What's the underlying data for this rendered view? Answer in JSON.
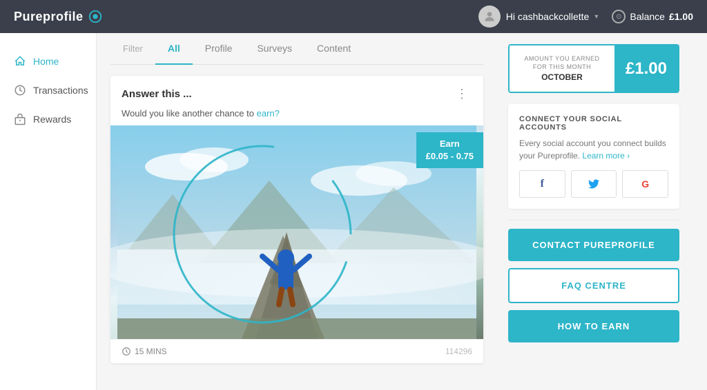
{
  "app": {
    "logo_text": "Pureprofile",
    "logo_icon": "◉"
  },
  "nav": {
    "user_greeting": "Hi cashbackcollette",
    "balance_label": "Balance",
    "balance_amount": "£1.00"
  },
  "sidebar": {
    "items": [
      {
        "id": "home",
        "label": "Home",
        "active": true,
        "icon": "home"
      },
      {
        "id": "transactions",
        "label": "Transactions",
        "active": false,
        "icon": "transactions"
      },
      {
        "id": "rewards",
        "label": "Rewards",
        "active": false,
        "icon": "rewards"
      }
    ]
  },
  "filter_tabs": {
    "static_label": "Filter",
    "tabs": [
      {
        "id": "all",
        "label": "All",
        "active": true
      },
      {
        "id": "profile",
        "label": "Profile",
        "active": false
      },
      {
        "id": "surveys",
        "label": "Surveys",
        "active": false
      },
      {
        "id": "content",
        "label": "Content",
        "active": false
      }
    ]
  },
  "card": {
    "title": "Answer this ...",
    "subtitle": "Would you like another chance to earn?",
    "subtitle_link": "earn",
    "earn_label_line1": "Earn",
    "earn_label_line2": "£0.05 - 0.75",
    "time_label": "15 MINS",
    "card_id": "114296"
  },
  "right_panel": {
    "earnings": {
      "top_text": "AMOUNT YOU EARNED FOR THIS MONTH",
      "month": "OCTOBER",
      "amount": "£1.00"
    },
    "social": {
      "title": "CONNECT YOUR SOCIAL ACCOUNTS",
      "description": "Every social account you connect builds your Pureprofile.",
      "learn_more": "Learn more ›",
      "buttons": [
        {
          "id": "facebook",
          "icon": "f"
        },
        {
          "id": "twitter",
          "icon": "t"
        },
        {
          "id": "google",
          "icon": "G"
        }
      ]
    },
    "action_buttons": [
      {
        "id": "contact",
        "label": "CONTACT PUREPROFILE",
        "style": "teal"
      },
      {
        "id": "faq",
        "label": "FAQ CENTRE",
        "style": "outline"
      },
      {
        "id": "how-to-earn",
        "label": "HOW TO EARN",
        "style": "teal"
      }
    ]
  }
}
